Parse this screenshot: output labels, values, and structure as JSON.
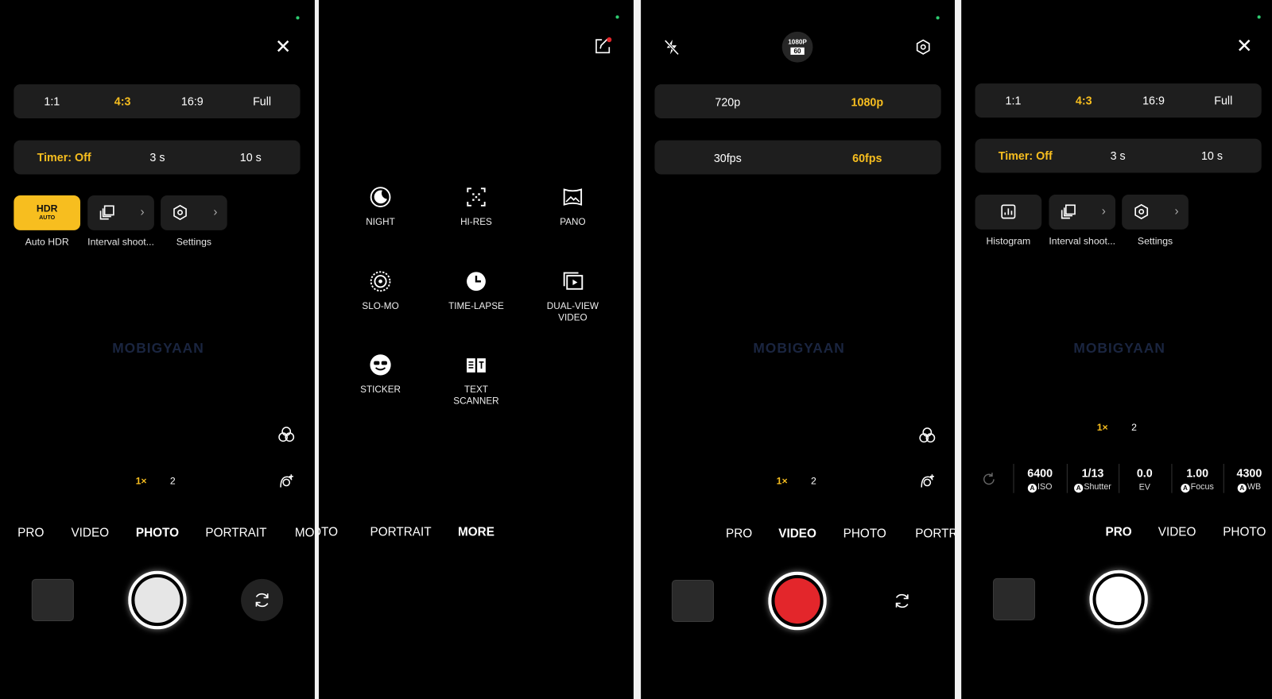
{
  "colors": {
    "accent": "#f7be1f",
    "record": "#e3262b",
    "status_dot": "#2ecc71"
  },
  "watermark": "MOBIGYAAN",
  "photo_panel": {
    "aspect_options": [
      "1:1",
      "4:3",
      "16:9",
      "Full"
    ],
    "aspect_selected": "4:3",
    "timer_options": [
      "Timer: Off",
      "3 s",
      "10 s"
    ],
    "timer_selected": "Timer: Off",
    "tiles": [
      {
        "label": "Auto HDR",
        "badge_top": "HDR",
        "badge_bottom": "AUTO",
        "active": true
      },
      {
        "label": "Interval shoot...",
        "icon": "interval-icon"
      },
      {
        "label": "Settings",
        "icon": "settings-icon"
      }
    ],
    "zoom": [
      "1×",
      "2"
    ],
    "modes": [
      "PRO",
      "VIDEO",
      "PHOTO",
      "PORTRAIT",
      "MORE"
    ],
    "mode_selected": "PHOTO"
  },
  "more_panel": {
    "items": [
      {
        "label": "NIGHT",
        "icon": "night-icon"
      },
      {
        "label": "HI-RES",
        "icon": "hi-res-icon"
      },
      {
        "label": "PANO",
        "icon": "pano-icon"
      },
      {
        "label": "SLO-MO",
        "icon": "slo-mo-icon"
      },
      {
        "label": "TIME-LAPSE",
        "icon": "time-lapse-icon"
      },
      {
        "label": "DUAL-VIEW\nVIDEO",
        "icon": "dual-view-icon"
      },
      {
        "label": "STICKER",
        "icon": "sticker-icon"
      },
      {
        "label": "TEXT\nSCANNER",
        "icon": "text-scanner-icon"
      }
    ],
    "modes": [
      "PHOTO",
      "PORTRAIT",
      "MORE"
    ],
    "mode_selected": "MORE"
  },
  "video_panel": {
    "badge_top": "1080P",
    "badge_bottom": "60",
    "resolution_options": [
      "720p",
      "1080p"
    ],
    "resolution_selected": "1080p",
    "fps_options": [
      "30fps",
      "60fps"
    ],
    "fps_selected": "60fps",
    "zoom": [
      "1×",
      "2"
    ],
    "modes": [
      "PRO",
      "VIDEO",
      "PHOTO",
      "PORTRAIT"
    ],
    "mode_selected": "VIDEO"
  },
  "pro_panel": {
    "aspect_options": [
      "1:1",
      "4:3",
      "16:9",
      "Full"
    ],
    "aspect_selected": "4:3",
    "timer_options": [
      "Timer: Off",
      "3 s",
      "10 s"
    ],
    "timer_selected": "Timer: Off",
    "tiles": [
      {
        "label": "Histogram",
        "icon": "histogram-icon"
      },
      {
        "label": "Interval shoot...",
        "icon": "interval-icon"
      },
      {
        "label": "Settings",
        "icon": "settings-icon"
      }
    ],
    "zoom": [
      "1×",
      "2"
    ],
    "params": [
      {
        "value": "6400",
        "label": "ISO",
        "auto": "A"
      },
      {
        "value": "1/13",
        "label": "Shutter",
        "auto": "A"
      },
      {
        "value": "0.0",
        "label": "EV"
      },
      {
        "value": "1.00",
        "label": "Focus",
        "auto": "A"
      },
      {
        "value": "4300",
        "label": "WB",
        "auto": "A"
      }
    ],
    "modes": [
      "PRO",
      "VIDEO",
      "PHOTO"
    ],
    "mode_selected": "PRO"
  }
}
